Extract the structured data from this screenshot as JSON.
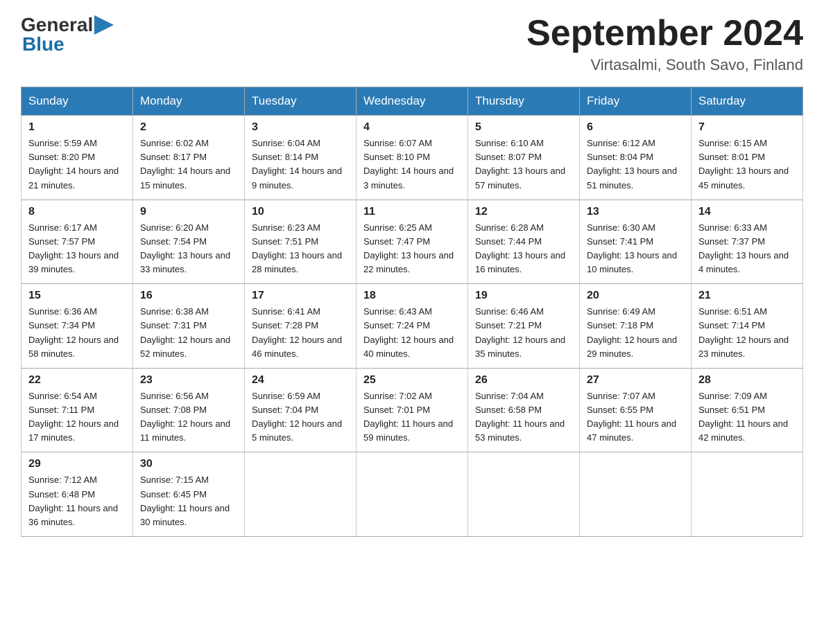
{
  "header": {
    "logo_general": "General",
    "logo_blue": "Blue",
    "month_title": "September 2024",
    "location": "Virtasalmi, South Savo, Finland"
  },
  "days_of_week": [
    "Sunday",
    "Monday",
    "Tuesday",
    "Wednesday",
    "Thursday",
    "Friday",
    "Saturday"
  ],
  "weeks": [
    [
      {
        "day": "1",
        "sunrise": "5:59 AM",
        "sunset": "8:20 PM",
        "daylight": "14 hours and 21 minutes."
      },
      {
        "day": "2",
        "sunrise": "6:02 AM",
        "sunset": "8:17 PM",
        "daylight": "14 hours and 15 minutes."
      },
      {
        "day": "3",
        "sunrise": "6:04 AM",
        "sunset": "8:14 PM",
        "daylight": "14 hours and 9 minutes."
      },
      {
        "day": "4",
        "sunrise": "6:07 AM",
        "sunset": "8:10 PM",
        "daylight": "14 hours and 3 minutes."
      },
      {
        "day": "5",
        "sunrise": "6:10 AM",
        "sunset": "8:07 PM",
        "daylight": "13 hours and 57 minutes."
      },
      {
        "day": "6",
        "sunrise": "6:12 AM",
        "sunset": "8:04 PM",
        "daylight": "13 hours and 51 minutes."
      },
      {
        "day": "7",
        "sunrise": "6:15 AM",
        "sunset": "8:01 PM",
        "daylight": "13 hours and 45 minutes."
      }
    ],
    [
      {
        "day": "8",
        "sunrise": "6:17 AM",
        "sunset": "7:57 PM",
        "daylight": "13 hours and 39 minutes."
      },
      {
        "day": "9",
        "sunrise": "6:20 AM",
        "sunset": "7:54 PM",
        "daylight": "13 hours and 33 minutes."
      },
      {
        "day": "10",
        "sunrise": "6:23 AM",
        "sunset": "7:51 PM",
        "daylight": "13 hours and 28 minutes."
      },
      {
        "day": "11",
        "sunrise": "6:25 AM",
        "sunset": "7:47 PM",
        "daylight": "13 hours and 22 minutes."
      },
      {
        "day": "12",
        "sunrise": "6:28 AM",
        "sunset": "7:44 PM",
        "daylight": "13 hours and 16 minutes."
      },
      {
        "day": "13",
        "sunrise": "6:30 AM",
        "sunset": "7:41 PM",
        "daylight": "13 hours and 10 minutes."
      },
      {
        "day": "14",
        "sunrise": "6:33 AM",
        "sunset": "7:37 PM",
        "daylight": "13 hours and 4 minutes."
      }
    ],
    [
      {
        "day": "15",
        "sunrise": "6:36 AM",
        "sunset": "7:34 PM",
        "daylight": "12 hours and 58 minutes."
      },
      {
        "day": "16",
        "sunrise": "6:38 AM",
        "sunset": "7:31 PM",
        "daylight": "12 hours and 52 minutes."
      },
      {
        "day": "17",
        "sunrise": "6:41 AM",
        "sunset": "7:28 PM",
        "daylight": "12 hours and 46 minutes."
      },
      {
        "day": "18",
        "sunrise": "6:43 AM",
        "sunset": "7:24 PM",
        "daylight": "12 hours and 40 minutes."
      },
      {
        "day": "19",
        "sunrise": "6:46 AM",
        "sunset": "7:21 PM",
        "daylight": "12 hours and 35 minutes."
      },
      {
        "day": "20",
        "sunrise": "6:49 AM",
        "sunset": "7:18 PM",
        "daylight": "12 hours and 29 minutes."
      },
      {
        "day": "21",
        "sunrise": "6:51 AM",
        "sunset": "7:14 PM",
        "daylight": "12 hours and 23 minutes."
      }
    ],
    [
      {
        "day": "22",
        "sunrise": "6:54 AM",
        "sunset": "7:11 PM",
        "daylight": "12 hours and 17 minutes."
      },
      {
        "day": "23",
        "sunrise": "6:56 AM",
        "sunset": "7:08 PM",
        "daylight": "12 hours and 11 minutes."
      },
      {
        "day": "24",
        "sunrise": "6:59 AM",
        "sunset": "7:04 PM",
        "daylight": "12 hours and 5 minutes."
      },
      {
        "day": "25",
        "sunrise": "7:02 AM",
        "sunset": "7:01 PM",
        "daylight": "11 hours and 59 minutes."
      },
      {
        "day": "26",
        "sunrise": "7:04 AM",
        "sunset": "6:58 PM",
        "daylight": "11 hours and 53 minutes."
      },
      {
        "day": "27",
        "sunrise": "7:07 AM",
        "sunset": "6:55 PM",
        "daylight": "11 hours and 47 minutes."
      },
      {
        "day": "28",
        "sunrise": "7:09 AM",
        "sunset": "6:51 PM",
        "daylight": "11 hours and 42 minutes."
      }
    ],
    [
      {
        "day": "29",
        "sunrise": "7:12 AM",
        "sunset": "6:48 PM",
        "daylight": "11 hours and 36 minutes."
      },
      {
        "day": "30",
        "sunrise": "7:15 AM",
        "sunset": "6:45 PM",
        "daylight": "11 hours and 30 minutes."
      },
      null,
      null,
      null,
      null,
      null
    ]
  ],
  "labels": {
    "sunrise": "Sunrise:",
    "sunset": "Sunset:",
    "daylight": "Daylight:"
  }
}
